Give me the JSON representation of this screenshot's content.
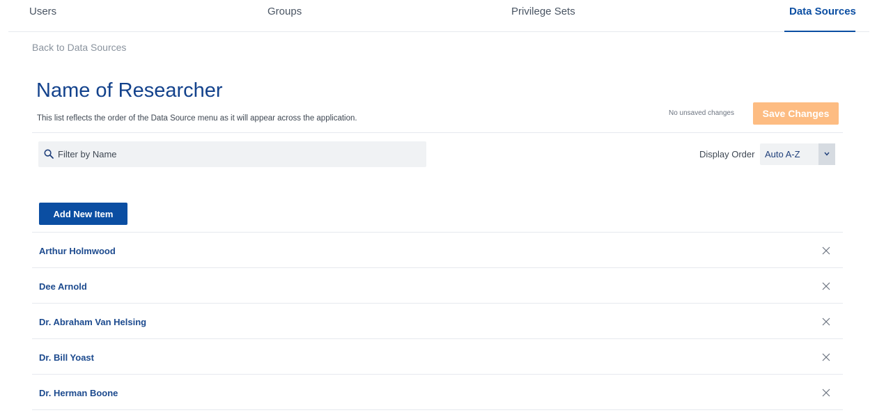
{
  "tabs": [
    {
      "label": "Users",
      "active": false
    },
    {
      "label": "Groups",
      "active": false
    },
    {
      "label": "Privilege Sets",
      "active": false
    },
    {
      "label": "Data Sources",
      "active": true
    }
  ],
  "back_link": "Back to Data Sources",
  "title": "Name of Researcher",
  "subtitle": "This list reflects the order of the Data Source menu as it will appear across the application.",
  "save_status": "No unsaved changes",
  "save_button": "Save Changes",
  "filter": {
    "placeholder": "Filter by Name",
    "value": "",
    "icon": "search-icon"
  },
  "display_order": {
    "label": "Display Order",
    "selected": "Auto A-Z",
    "icon": "chevron-down-icon"
  },
  "add_button": "Add New Item",
  "items": [
    {
      "name": "Arthur Holmwood"
    },
    {
      "name": "Dee Arnold"
    },
    {
      "name": "Dr. Abraham Van Helsing"
    },
    {
      "name": "Dr. Bill Yoast"
    },
    {
      "name": "Dr. Herman Boone"
    }
  ],
  "remove_icon": "close-icon",
  "colors": {
    "primary": "#0b4ea2",
    "save_disabled": "#fdbc82",
    "link_gray": "#8a939e",
    "divider": "#e6e9ee"
  }
}
